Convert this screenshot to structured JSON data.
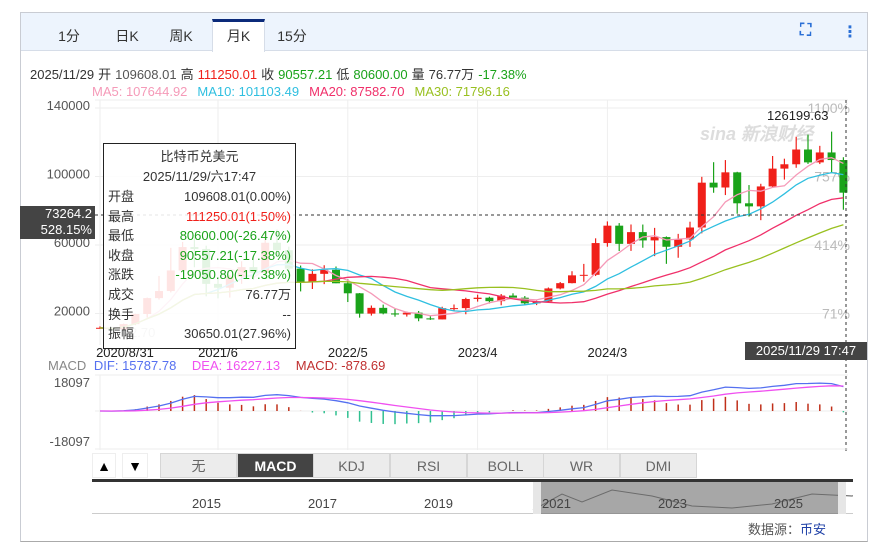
{
  "tabs": [
    {
      "label": "1分"
    },
    {
      "label": "日K"
    },
    {
      "label": "周K"
    },
    {
      "label": "月K",
      "active": true
    },
    {
      "label": "15分"
    }
  ],
  "toolbar": {
    "fullscreen_icon": "fullscreen-icon",
    "more_icon": "more-vertical-icon"
  },
  "info": {
    "date": "2025/11/29",
    "open_label": "开",
    "open": "109608.01",
    "high_label": "高",
    "high": "111250.01",
    "close_label": "收",
    "close": "90557.21",
    "low_label": "低",
    "low": "80600.00",
    "vol_label": "量",
    "vol": "76.77万",
    "chg": "-17.38%"
  },
  "ma": {
    "ma5": "MA5: 107644.92",
    "ma10": "MA10: 101103.49",
    "ma20": "MA20: 87582.70",
    "ma30": "MA30: 71796.16"
  },
  "colors": {
    "up": "#f0201a",
    "down": "#1aa31a",
    "ma5": "#f59ab8",
    "ma10": "#2fbfe0",
    "ma20": "#f0306a",
    "ma30": "#99c020",
    "dif": "#5570f0",
    "dea": "#f050f0"
  },
  "tooltip": {
    "title": "比特币兑美元",
    "datetime": "2025/11/29/六17:47",
    "rows": [
      {
        "k": "开盘",
        "v": "109608.01(0.00%)",
        "c": "#333"
      },
      {
        "k": "最高",
        "v": "111250.01(1.50%)",
        "c": "#f0201a"
      },
      {
        "k": "最低",
        "v": "80600.00(-26.47%)",
        "c": "#1aa31a"
      },
      {
        "k": "收盘",
        "v": "90557.21(-17.38%)",
        "c": "#1aa31a"
      },
      {
        "k": "涨跌",
        "v": "-19050.80(-17.38%)",
        "c": "#1aa31a"
      },
      {
        "k": "成交",
        "v": "76.77万",
        "c": "#333"
      },
      {
        "k": "换手",
        "v": "--",
        "c": "#333"
      },
      {
        "k": "振幅",
        "v": "30650.01(27.96%)",
        "c": "#333"
      }
    ]
  },
  "crosshair": {
    "price": "73264.2",
    "pct": "528.15%",
    "date": "2025/11/29 17:47"
  },
  "max_label": "126199.63",
  "low_label_partial": "2.70",
  "watermark": "sina 新浪财经",
  "chart_data": {
    "type": "candlestick",
    "y_ticks": [
      "140000",
      "100000",
      "60000",
      "20000"
    ],
    "y_tick_values": [
      140000,
      100000,
      60000,
      20000
    ],
    "pct_ticks": [
      "1100%",
      "757%",
      "414%",
      "71%"
    ],
    "x_labels": [
      "2020/8/31",
      "2021/6",
      "2022/5",
      "2023/4",
      "2024/3"
    ],
    "x_label_index": [
      0,
      10,
      21,
      32,
      43
    ],
    "ylim": [
      20000,
      140000
    ],
    "ohlc": [
      [
        11350,
        12470,
        11120,
        11660
      ],
      [
        11660,
        12050,
        9880,
        10780
      ],
      [
        10780,
        14100,
        10550,
        13800
      ],
      [
        13800,
        19860,
        13200,
        19700
      ],
      [
        19700,
        29300,
        17600,
        28990
      ],
      [
        28990,
        41950,
        28130,
        33110
      ],
      [
        33110,
        58350,
        32300,
        45140
      ],
      [
        45140,
        61790,
        45000,
        58800
      ],
      [
        58800,
        64850,
        47000,
        57700
      ],
      [
        57700,
        59600,
        30000,
        37300
      ],
      [
        37300,
        41300,
        28800,
        35050
      ],
      [
        35050,
        42400,
        29300,
        41460
      ],
      [
        41460,
        50500,
        37330,
        47100
      ],
      [
        47100,
        52900,
        39600,
        43820
      ],
      [
        43820,
        67000,
        43280,
        61300
      ],
      [
        61300,
        69000,
        53250,
        56950
      ],
      [
        56950,
        59050,
        42000,
        46200
      ],
      [
        46200,
        47990,
        32900,
        38470
      ],
      [
        38470,
        45800,
        34300,
        43160
      ],
      [
        43160,
        48190,
        37150,
        45510
      ],
      [
        45510,
        47440,
        37700,
        37640
      ],
      [
        37640,
        40000,
        26700,
        31800
      ],
      [
        31800,
        31950,
        17570,
        19930
      ],
      [
        19930,
        24670,
        18780,
        23300
      ],
      [
        23300,
        25200,
        19520,
        20050
      ],
      [
        20050,
        22800,
        18150,
        19420
      ],
      [
        19420,
        21080,
        18190,
        20490
      ],
      [
        20490,
        21480,
        15480,
        17160
      ],
      [
        17160,
        18390,
        16260,
        16540
      ],
      [
        16540,
        23960,
        16500,
        23125
      ],
      [
        23125,
        25250,
        21350,
        23140
      ],
      [
        23140,
        29200,
        19550,
        28480
      ],
      [
        28480,
        31000,
        26940,
        29230
      ],
      [
        29230,
        29820,
        25810,
        27210
      ],
      [
        27210,
        31390,
        24800,
        30470
      ],
      [
        30470,
        31800,
        28860,
        29230
      ],
      [
        29230,
        30200,
        25170,
        25940
      ],
      [
        25940,
        27480,
        24900,
        26960
      ],
      [
        26960,
        35200,
        26540,
        34640
      ],
      [
        34640,
        38400,
        34100,
        37720
      ],
      [
        37720,
        44700,
        37600,
        42280
      ],
      [
        42280,
        48970,
        38550,
        42580
      ],
      [
        42580,
        63900,
        41880,
        61130
      ],
      [
        61130,
        73780,
        59000,
        71290
      ],
      [
        71290,
        72800,
        56500,
        60670
      ],
      [
        60670,
        71980,
        56550,
        67520
      ],
      [
        67520,
        71950,
        58400,
        62680
      ],
      [
        62680,
        70000,
        53500,
        64620
      ],
      [
        64620,
        65000,
        49000,
        58970
      ],
      [
        58970,
        66500,
        52550,
        63330
      ],
      [
        63330,
        73600,
        58900,
        70220
      ],
      [
        70220,
        99800,
        66800,
        96400
      ],
      [
        96400,
        108350,
        90500,
        93580
      ],
      [
        93580,
        109600,
        89160,
        102430
      ],
      [
        102430,
        102750,
        78260,
        84350
      ],
      [
        84350,
        95000,
        76600,
        82550
      ],
      [
        82550,
        95750,
        74500,
        94200
      ],
      [
        94200,
        111980,
        93350,
        104600
      ],
      [
        104600,
        110400,
        98200,
        107140
      ],
      [
        107140,
        123220,
        105100,
        115760
      ],
      [
        115760,
        124470,
        107350,
        108240
      ],
      [
        108240,
        117900,
        107270,
        114050
      ],
      [
        114050,
        126199.63,
        102000,
        109608
      ],
      [
        109608.01,
        111250.01,
        80600,
        90557.21
      ]
    ]
  },
  "macd": {
    "label": "MACD",
    "dif": "DIF: 15787.78",
    "dea": "DEA: 16227.13",
    "macd": "MACD: -878.69",
    "top": "18097",
    "bottom": "-18097",
    "range": 18097
  },
  "indicator_buttons": [
    {
      "label": "无"
    },
    {
      "label": "MACD",
      "active": true
    },
    {
      "label": "KDJ"
    },
    {
      "label": "RSI"
    },
    {
      "label": "BOLL"
    },
    {
      "label": "WR"
    },
    {
      "label": "DMI"
    }
  ],
  "navigator": {
    "years": [
      "2015",
      "2017",
      "2019",
      "2021",
      "2023",
      "2025"
    ]
  },
  "source": {
    "label": "数据源：",
    "value": "币安"
  }
}
